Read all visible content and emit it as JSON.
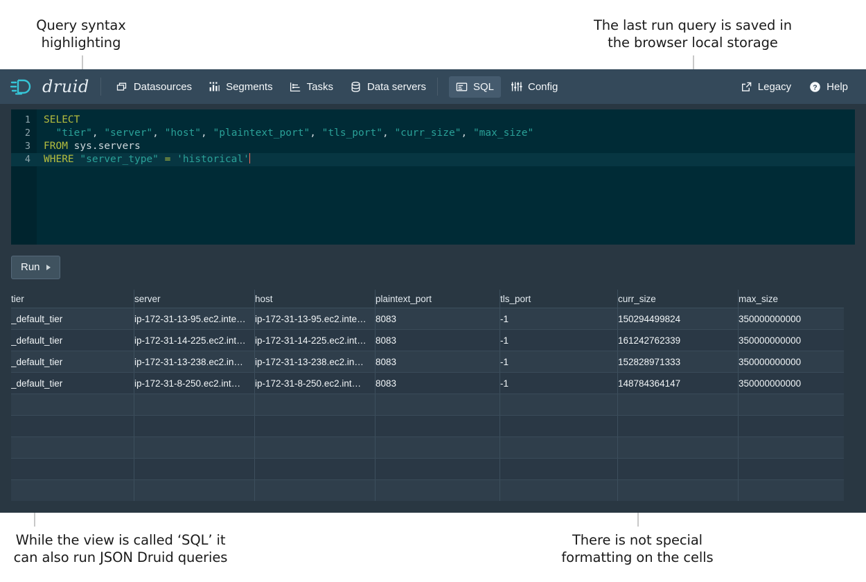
{
  "annotations": [
    {
      "text": "Query syntax\nhighlighting"
    },
    {
      "text": "The last run query is saved in\nthe browser local storage"
    },
    {
      "text": "While the view is called ‘SQL’ it\ncan also run JSON Druid queries"
    },
    {
      "text": "There is not special\nformatting on the cells"
    }
  ],
  "navbar": {
    "brand": "druid",
    "brand_icon": "druid-logo-icon",
    "items": [
      {
        "label": "Datasources",
        "icon": "datasources-icon",
        "active": false
      },
      {
        "label": "Segments",
        "icon": "segments-icon",
        "active": false
      },
      {
        "label": "Tasks",
        "icon": "tasks-icon",
        "active": false
      },
      {
        "label": "Data servers",
        "icon": "data-servers-icon",
        "active": false
      },
      {
        "label": "SQL",
        "icon": "sql-icon",
        "active": true
      },
      {
        "label": "Config",
        "icon": "config-icon",
        "active": false
      }
    ],
    "right_items": [
      {
        "label": "Legacy",
        "icon": "external-link-icon"
      },
      {
        "label": "Help",
        "icon": "help-icon"
      }
    ]
  },
  "editor": {
    "lines": [
      {
        "num": "1",
        "tokens": [
          {
            "t": "SELECT",
            "c": "kw"
          }
        ]
      },
      {
        "num": "2",
        "tokens": [
          {
            "t": "  ",
            "c": "plain"
          },
          {
            "t": "\"tier\"",
            "c": "str"
          },
          {
            "t": ", ",
            "c": "plain"
          },
          {
            "t": "\"server\"",
            "c": "str"
          },
          {
            "t": ", ",
            "c": "plain"
          },
          {
            "t": "\"host\"",
            "c": "str"
          },
          {
            "t": ", ",
            "c": "plain"
          },
          {
            "t": "\"plaintext_port\"",
            "c": "str"
          },
          {
            "t": ", ",
            "c": "plain"
          },
          {
            "t": "\"tls_port\"",
            "c": "str"
          },
          {
            "t": ", ",
            "c": "plain"
          },
          {
            "t": "\"curr_size\"",
            "c": "str"
          },
          {
            "t": ", ",
            "c": "plain"
          },
          {
            "t": "\"max_size\"",
            "c": "str"
          }
        ]
      },
      {
        "num": "3",
        "tokens": [
          {
            "t": "FROM",
            "c": "kw"
          },
          {
            "t": " ",
            "c": "plain"
          },
          {
            "t": "sys.servers",
            "c": "plain"
          }
        ]
      },
      {
        "num": "4",
        "current": true,
        "tokens": [
          {
            "t": "WHERE",
            "c": "kw"
          },
          {
            "t": " ",
            "c": "plain"
          },
          {
            "t": "\"server_type\"",
            "c": "str"
          },
          {
            "t": " ",
            "c": "plain"
          },
          {
            "t": "=",
            "c": "op"
          },
          {
            "t": " ",
            "c": "plain"
          },
          {
            "t": "'historical'",
            "c": "str"
          }
        ]
      }
    ],
    "blank_lines": 6
  },
  "run_button": {
    "label": "Run",
    "icon": "play-caret-icon"
  },
  "results": {
    "columns": [
      "tier",
      "server",
      "host",
      "plaintext_port",
      "tls_port",
      "curr_size",
      "max_size"
    ],
    "rows": [
      [
        "_default_tier",
        "ip-172-31-13-95.ec2.inte…",
        "ip-172-31-13-95.ec2.inte…",
        "8083",
        "-1",
        "150294499824",
        "350000000000"
      ],
      [
        "_default_tier",
        "ip-172-31-14-225.ec2.int…",
        "ip-172-31-14-225.ec2.int…",
        "8083",
        "-1",
        "161242762339",
        "350000000000"
      ],
      [
        "_default_tier",
        "ip-172-31-13-238.ec2.in…",
        "ip-172-31-13-238.ec2.in…",
        "8083",
        "-1",
        "152828971333",
        "350000000000"
      ],
      [
        "_default_tier",
        "ip-172-31-8-250.ec2.int…",
        "ip-172-31-8-250.ec2.int…",
        "8083",
        "-1",
        "148784364147",
        "350000000000"
      ],
      [
        "",
        "",
        "",
        "",
        "",
        "",
        ""
      ],
      [
        "",
        "",
        "",
        "",
        "",
        "",
        ""
      ],
      [
        "",
        "",
        "",
        "",
        "",
        "",
        ""
      ],
      [
        "",
        "",
        "",
        "",
        "",
        "",
        ""
      ],
      [
        "",
        "",
        "",
        "",
        "",
        "",
        ""
      ],
      [
        "",
        "",
        "",
        "",
        "",
        "",
        ""
      ]
    ]
  },
  "colors": {
    "app_bg": "#293742",
    "navbar_bg": "#34495a",
    "editor_bg": "#002b36",
    "accent_cyan": "#36c5d6",
    "keyword": "#b5bd3e",
    "string": "#2aa198"
  }
}
